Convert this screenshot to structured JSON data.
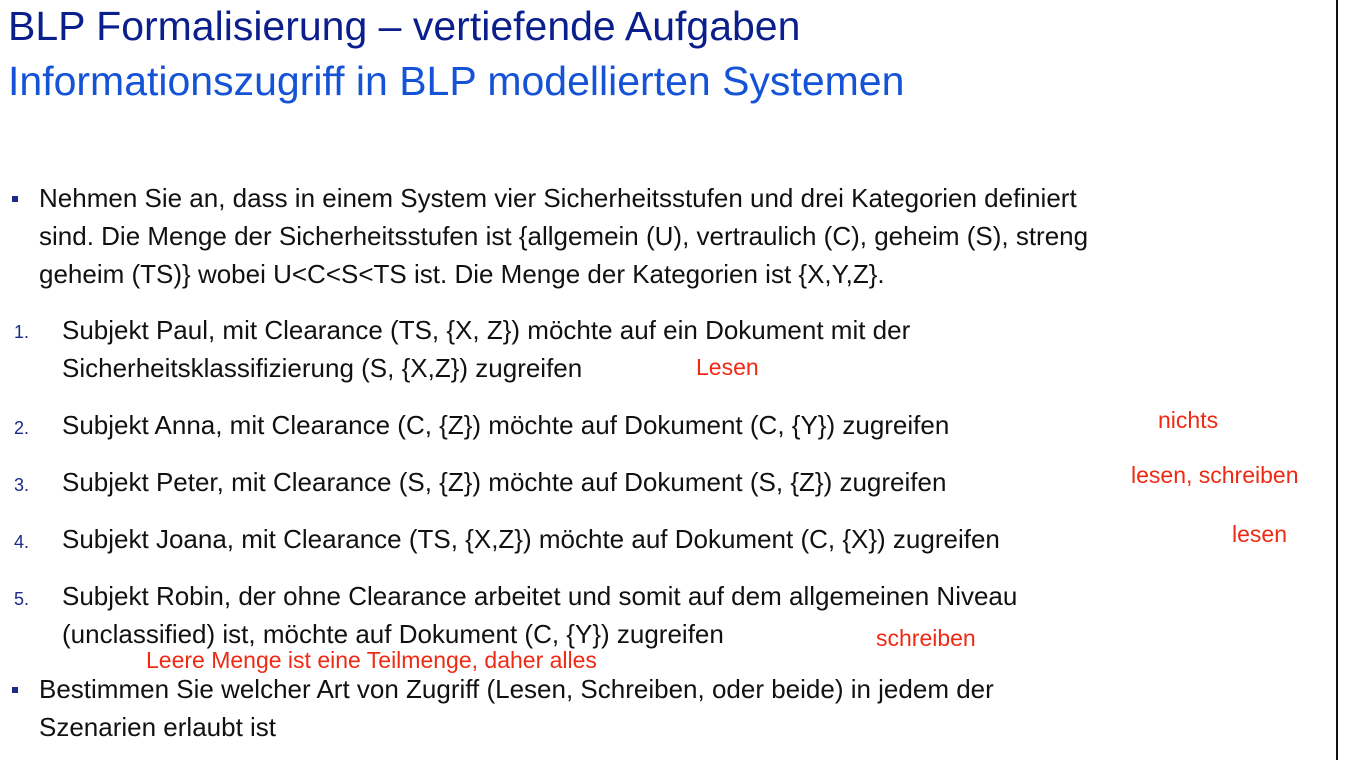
{
  "title": "BLP Formalisierung – vertiefende Aufgaben",
  "subtitle": "Informationszugriff in BLP modellierten Systemen",
  "intro_lines": [
    "Nehmen Sie an, dass in einem System vier Sicherheitsstufen und drei Kategorien definiert",
    "sind. Die Menge der Sicherheitsstufen ist {allgemein (U), vertraulich (C), geheim (S), streng",
    "geheim (TS)} wobei U<C<S<TS ist. Die Menge der Kategorien ist {X,Y,Z}."
  ],
  "items": [
    {
      "num": "1.",
      "lines": [
        "Subjekt Paul, mit Clearance (TS, {X, Z}) möchte auf ein Dokument mit der",
        "Sicherheitsklassifizierung (S, {X,Z}) zugreifen"
      ],
      "note": "Lesen"
    },
    {
      "num": "2.",
      "lines": [
        "Subjekt Anna, mit Clearance (C, {Z}) möchte auf Dokument (C, {Y}) zugreifen"
      ],
      "note": "nichts"
    },
    {
      "num": "3.",
      "lines": [
        "Subjekt Peter, mit Clearance (S, {Z}) möchte auf Dokument (S, {Z}) zugreifen"
      ],
      "note": "lesen, schreiben"
    },
    {
      "num": "4.",
      "lines": [
        "Subjekt Joana, mit Clearance (TS, {X,Z}) möchte auf Dokument (C, {X}) zugreifen"
      ],
      "note": "lesen"
    },
    {
      "num": "5.",
      "lines": [
        "Subjekt Robin, der ohne Clearance arbeitet und somit auf dem allgemeinen Niveau",
        "(unclassified) ist, möchte auf Dokument (C, {Y}) zugreifen"
      ],
      "note": "schreiben"
    }
  ],
  "annotation_5": "Leere Menge ist eine Teilmenge, daher alles",
  "final_lines": [
    "Bestimmen Sie welcher Art von Zugriff (Lesen, Schreiben, oder beide) in jedem der",
    "Szenarien erlaubt ist"
  ]
}
